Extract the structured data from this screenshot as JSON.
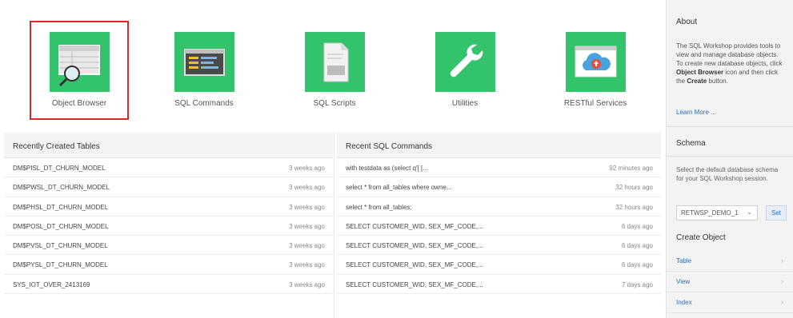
{
  "tiles": [
    {
      "label": "Object Browser",
      "icon": "object-browser-icon"
    },
    {
      "label": "SQL Commands",
      "icon": "sql-commands-icon"
    },
    {
      "label": "SQL Scripts",
      "icon": "sql-scripts-icon"
    },
    {
      "label": "Utilities",
      "icon": "wrench-icon"
    },
    {
      "label": "RESTful Services",
      "icon": "cloud-upload-icon"
    }
  ],
  "recent_tables": {
    "title": "Recently Created Tables",
    "rows": [
      {
        "name": "DM$PISL_DT_CHURN_MODEL",
        "time": "3 weeks ago"
      },
      {
        "name": "DM$PWSL_DT_CHURN_MODEL",
        "time": "3 weeks ago"
      },
      {
        "name": "DM$PHSL_DT_CHURN_MODEL",
        "time": "3 weeks ago"
      },
      {
        "name": "DM$POSL_DT_CHURN_MODEL",
        "time": "3 weeks ago"
      },
      {
        "name": "DM$PVSL_DT_CHURN_MODEL",
        "time": "3 weeks ago"
      },
      {
        "name": "DM$PYSL_DT_CHURN_MODEL",
        "time": "3 weeks ago"
      },
      {
        "name": "SYS_IOT_OVER_2413169",
        "time": "3 weeks ago"
      }
    ]
  },
  "recent_sql": {
    "title": "Recent SQL Commands",
    "rows": [
      {
        "name": "with testdata as (select q'[ [...",
        "time": "92 minutes ago"
      },
      {
        "name": "select * from all_tables where owne...",
        "time": "32 hours ago"
      },
      {
        "name": "select * from all_tables;",
        "time": "32 hours ago"
      },
      {
        "name": "SELECT CUSTOMER_WID, SEX_MF_CODE,...",
        "time": "6 days ago"
      },
      {
        "name": "SELECT CUSTOMER_WID, SEX_MF_CODE,...",
        "time": "6 days ago"
      },
      {
        "name": "SELECT CUSTOMER_WID, SEX_MF_CODE,...",
        "time": "6 days ago"
      },
      {
        "name": "SELECT CUSTOMER_WID, SEX_MF_CODE,...",
        "time": "7 days ago"
      }
    ]
  },
  "sidebar": {
    "about_title": "About",
    "about_text_1": "The SQL Workshop provides tools to view and manage database objects. To create new database objects, click ",
    "about_bold_1": "Object Browser",
    "about_text_2": " icon and then click the ",
    "about_bold_2": "Create",
    "about_text_3": " button.",
    "learn_more": "Learn More ...",
    "schema_title": "Schema",
    "schema_text": "Select the default database schema for your SQL Workshop session.",
    "schema_value": "RETWSP_DEMO_1",
    "set_label": "Set",
    "create_title": "Create Object",
    "create_items": [
      "Table",
      "View",
      "Index"
    ]
  },
  "colors": {
    "tile_green": "#33c36a",
    "selected_outline": "#e0282a",
    "link": "#2c6fb8"
  }
}
